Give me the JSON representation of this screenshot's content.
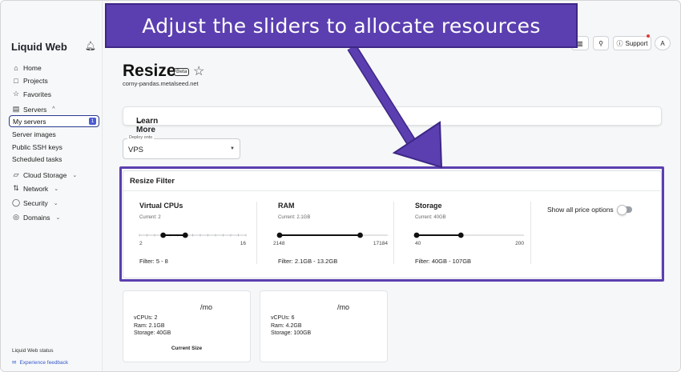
{
  "callout": {
    "text": "Adjust the sliders to allocate resources"
  },
  "sidebar": {
    "brand": "Liquid Web",
    "items": [
      {
        "label": "Home",
        "icon": "home-icon"
      },
      {
        "label": "Projects",
        "icon": "folder-icon"
      },
      {
        "label": "Favorites",
        "icon": "star-icon"
      },
      {
        "label": "Servers",
        "icon": "server-icon"
      }
    ],
    "servers_sub": [
      {
        "label": "My servers",
        "badge": "1"
      },
      {
        "label": "Server images"
      },
      {
        "label": "Public SSH keys"
      },
      {
        "label": "Scheduled tasks"
      }
    ],
    "more_items": [
      {
        "label": "Cloud Storage",
        "icon": "cloud-storage-icon"
      },
      {
        "label": "Network",
        "icon": "network-icon"
      },
      {
        "label": "Security",
        "icon": "shield-icon"
      },
      {
        "label": "Domains",
        "icon": "globe-icon"
      }
    ],
    "status": "Liquid Web status",
    "feedback": "Experience feedback"
  },
  "topbar": {
    "support": "Support",
    "avatar": "A"
  },
  "page": {
    "title": "Resize",
    "beta": "Beta",
    "subtitle": "corny-pandas.metalseed.net",
    "learn_more": "Learn More",
    "deploy": {
      "label": "Deploy onto",
      "value": "VPS"
    }
  },
  "filter": {
    "title": "Resize Filter",
    "columns": [
      {
        "name": "Virtual CPUs",
        "current": "Current: 2",
        "min": "2",
        "max": "16",
        "filter": "Filter: 5 - 8",
        "range": [
          2,
          16
        ],
        "low": 5,
        "high": 8,
        "ticks": 15
      },
      {
        "name": "RAM",
        "current": "Current: 2.1GB",
        "min": "2148",
        "max": "17184",
        "filter": "Filter: 2.1GB - 13.2GB",
        "range": [
          2148,
          17184
        ],
        "low": 2148,
        "high": 13514,
        "ticks": 0
      },
      {
        "name": "Storage",
        "current": "Current: 40GB",
        "min": "40",
        "max": "200",
        "filter": "Filter: 40GB - 107GB",
        "range": [
          40,
          200
        ],
        "low": 40,
        "high": 107,
        "ticks": 0
      }
    ],
    "price_options": "Show all price options"
  },
  "plans": [
    {
      "mo": "/mo",
      "vcpus": "vCPUs: 2",
      "ram": "Ram: 2.1GB",
      "storage": "Storage: 40GB",
      "footer": "Current Size"
    },
    {
      "mo": "/mo",
      "vcpus": "vCPUs: 6",
      "ram": "Ram: 4.2GB",
      "storage": "Storage: 100GB",
      "footer": ""
    }
  ],
  "colors": {
    "accent": "#5b3fb0",
    "badge": "#4a5bd4",
    "link": "#3558c9"
  }
}
